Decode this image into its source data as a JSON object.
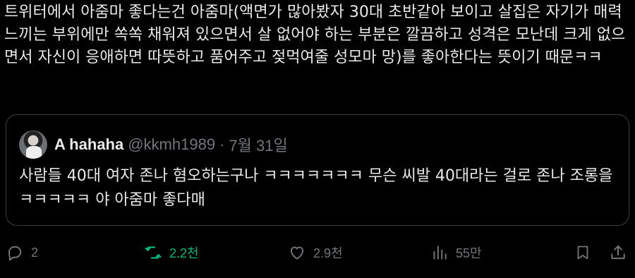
{
  "tweet": {
    "text": "트위터에서 아줌마 좋다는건 아줌마(액면가 많아봤자 30대 초반같아 보이고 살집은 자기가 매력 느끼는 부위에만 쏙쏙 채워져 있으면서 살 없어야 하는 부분은 깔끔하고 성격은 모난데 크게 없으면서 자신이 응애하면 따뜻하고 품어주고 젖먹여줄 성모마 망)를 좋아한다는 뜻이기 때문ㅋㅋ"
  },
  "quote": {
    "author_name": "A hahaha",
    "author_handle": "@kkmh1989",
    "separator": "·",
    "date": "7월 31일",
    "text": "사람들 40대 여자 존나 혐오하는구나 ㅋㅋㅋㅋㅋㅋㅋ 무슨 씨발 40대라는 걸로 존나 조롱을 ㅋㅋㅋㅋㅋ 야 아줌마 좋다매"
  },
  "actions": {
    "reply_count": "2",
    "retweet_count": "2.2천",
    "like_count": "2.9천",
    "views_count": "55만"
  },
  "colors": {
    "background": "#000000",
    "text": "#e7e9ea",
    "muted": "#71767b",
    "retweet_green": "#00ba7c",
    "border": "#3a3d41"
  },
  "icons": {
    "reply": "speech-bubble-icon",
    "retweet": "retweet-arrows-icon",
    "like": "heart-icon",
    "views": "bar-chart-icon",
    "bookmark": "bookmark-icon",
    "share": "share-upload-icon"
  }
}
